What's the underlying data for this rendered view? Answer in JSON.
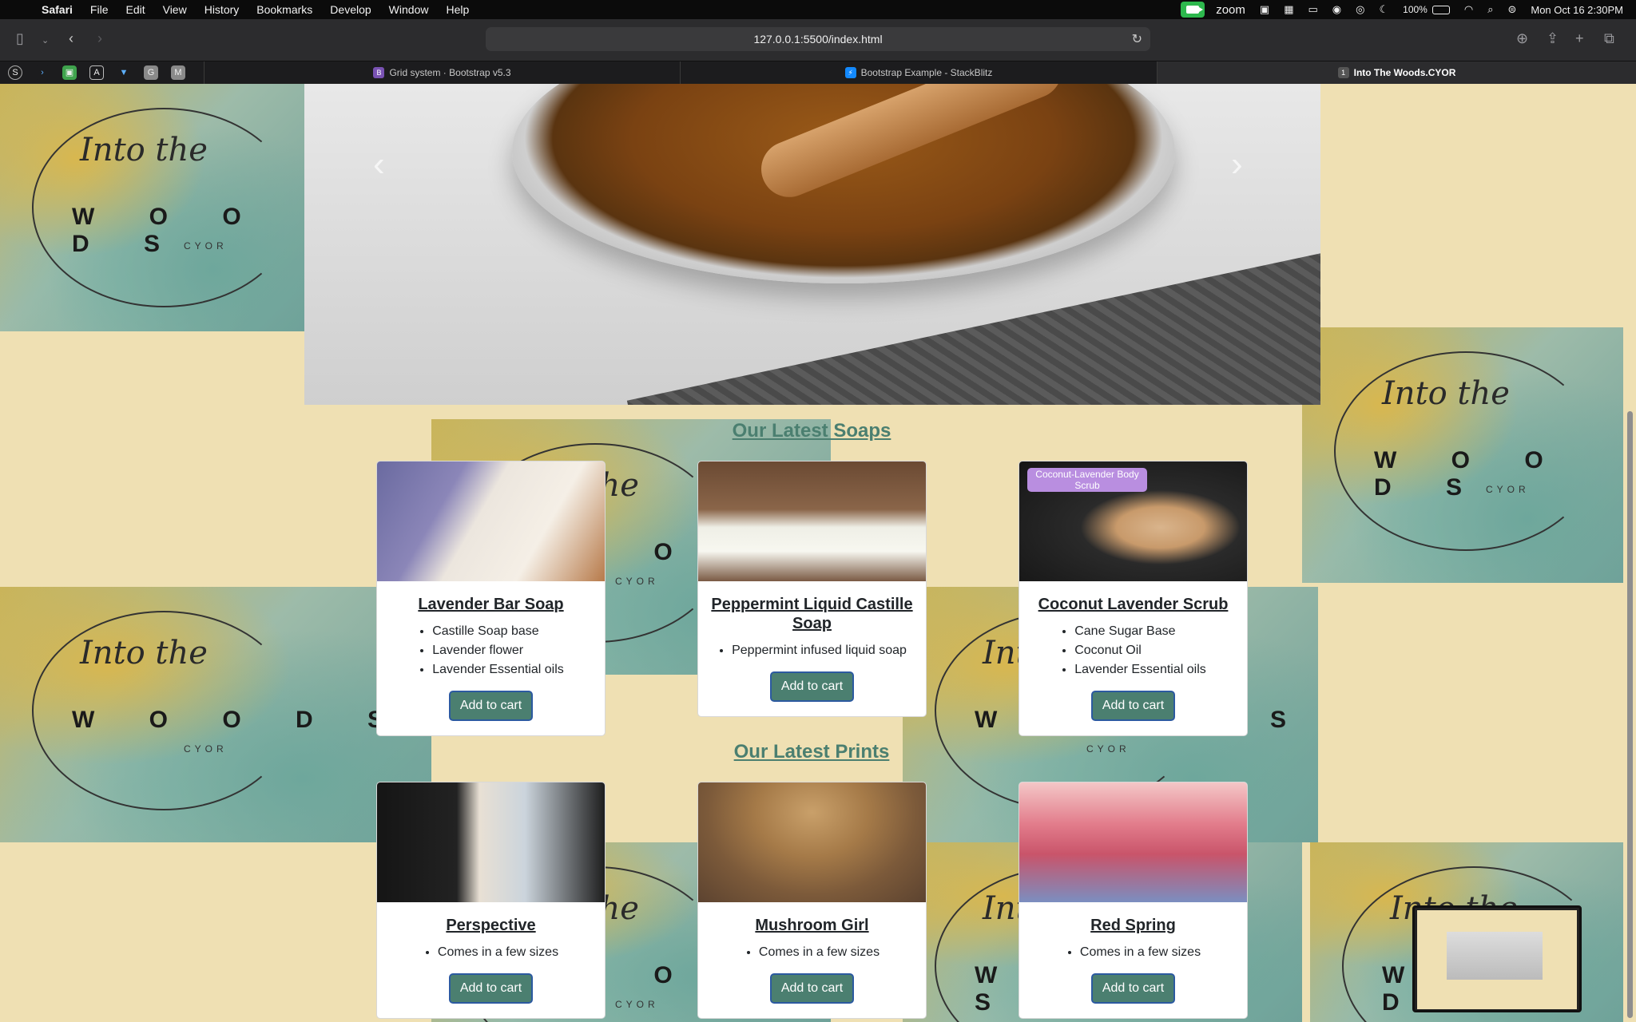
{
  "menubar": {
    "app": "Safari",
    "items": [
      "File",
      "Edit",
      "View",
      "History",
      "Bookmarks",
      "Develop",
      "Window",
      "Help"
    ],
    "zoom_label": "zoom",
    "battery": "100%",
    "battery_level": 1.0,
    "datetime": "Mon Oct 16  2:30PM"
  },
  "toolbar": {
    "url": "127.0.0.1:5500/index.html"
  },
  "tabs": {
    "pinned": [
      "S",
      "›",
      "▣",
      "A",
      "▼",
      "G",
      "M"
    ],
    "items": [
      {
        "label": "Grid system · Bootstrap v5.3",
        "favicon": "B",
        "color": "#7952b3"
      },
      {
        "label": "Bootstrap Example - StackBlitz",
        "favicon": "⚡",
        "color": "#1389fd"
      },
      {
        "label": "Into The Woods.CYOR",
        "favicon": "1",
        "color": "#555555"
      }
    ]
  },
  "logo": {
    "script": "Into the",
    "name": "W O O D S",
    "sub": "CYOR"
  },
  "carousel": {
    "prev": "‹",
    "next": "›"
  },
  "soaps": {
    "heading": "Our Latest Soaps",
    "cards": [
      {
        "title": "Lavender Bar Soap",
        "bullets": [
          "Castille Soap base",
          "Lavender flower",
          "Lavender Essential oils"
        ],
        "button": "Add to cart"
      },
      {
        "title": "Peppermint Liquid Castille Soap",
        "bullets": [
          "Peppermint infused liquid soap"
        ],
        "button": "Add to cart"
      },
      {
        "title": "Coconut Lavender Scrub",
        "bullets": [
          "Cane Sugar Base",
          "Coconut Oil",
          "Lavender Essential oils"
        ],
        "button": "Add to cart",
        "image_tag": "Coconut-Lavender Body Scrub"
      }
    ]
  },
  "prints": {
    "heading": "Our Latest Prints",
    "cards": [
      {
        "title": "Perspective",
        "bullets": [
          "Comes in a few sizes"
        ],
        "button": "Add to cart"
      },
      {
        "title": "Mushroom Girl",
        "bullets": [
          "Comes in a few sizes"
        ],
        "button": "Add to cart"
      },
      {
        "title": "Red Spring",
        "bullets": [
          "Comes in a few sizes"
        ],
        "button": "Add to cart"
      }
    ]
  },
  "colors": {
    "accent": "#4b7f70",
    "page_bg": "#efe0b3",
    "button_border": "#2c5aa0"
  }
}
